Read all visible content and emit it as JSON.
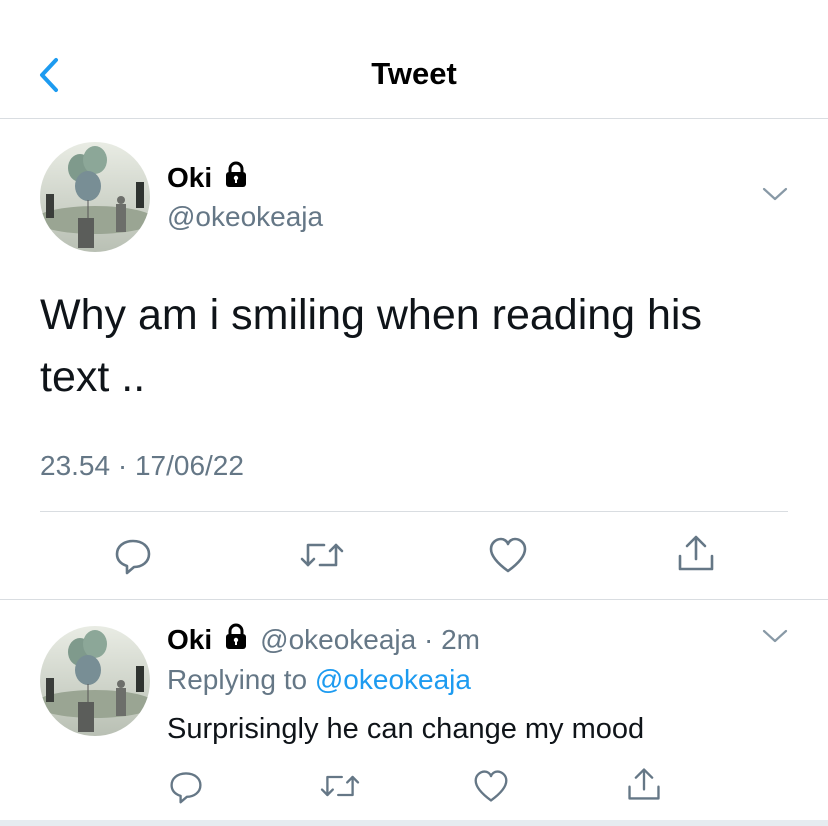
{
  "header": {
    "title": "Tweet",
    "back_icon": "chevron-left-icon",
    "accent": "#1d9bf0"
  },
  "main_tweet": {
    "display_name": "Oki",
    "handle": "@okeokeaja",
    "text_line1": "Why am i smiling when reading his",
    "text_line2": "text ..",
    "timestamp": "23.54 · 17/06/22",
    "actions": [
      "reply-icon",
      "retweet-icon",
      "like-icon",
      "share-icon"
    ]
  },
  "reply_tweet": {
    "display_name": "Oki",
    "handle_time": "@okeokeaja · 2m",
    "replying_prefix": "Replying to",
    "replying_to": "@okeokeaja",
    "text": "Surprisingly he can change my mood",
    "actions": [
      "reply-icon",
      "retweet-icon",
      "like-icon",
      "share-icon"
    ]
  },
  "colors": {
    "text_primary": "#0f1419",
    "text_secondary": "#657786",
    "divider": "#d9dde1",
    "link": "#1d9bf0"
  }
}
